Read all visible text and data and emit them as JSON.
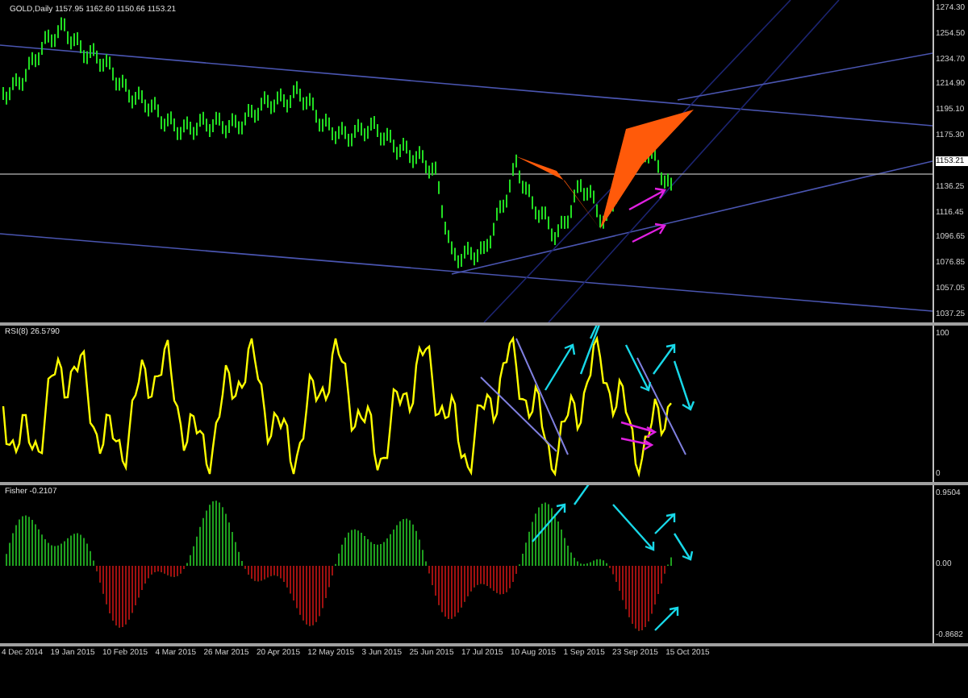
{
  "header": {
    "title": "GOLD,Daily",
    "quote": "1157.95 1162.60 1150.66 1153.21"
  },
  "price_panel": {
    "axis_labels": [
      "1274.30",
      "1254.50",
      "1234.70",
      "1214.90",
      "1195.10",
      "1175.30",
      "1136.25",
      "1116.45",
      "1096.65",
      "1076.85",
      "1057.05",
      "1037.25"
    ],
    "current_price": "1153.21"
  },
  "rsi_panel": {
    "label": "RSI(8) 26.5790",
    "axis_labels": [
      "100",
      "0"
    ]
  },
  "fisher_panel": {
    "label": "Fisher -0.2107",
    "axis_labels": [
      "0.9504",
      "0.00",
      "-0.8682"
    ]
  },
  "time_axis": {
    "labels": [
      "4 Dec 2014",
      "19 Jan 2015",
      "10 Feb 2015",
      "4 Mar 2015",
      "26 Mar 2015",
      "20 Apr 2015",
      "12 May 2015",
      "3 Jun 2015",
      "25 Jun 2015",
      "17 Jul 2015",
      "10 Aug 2015",
      "1 Sep 2015",
      "23 Sep 2015",
      "15 Oct 2015"
    ]
  }
}
